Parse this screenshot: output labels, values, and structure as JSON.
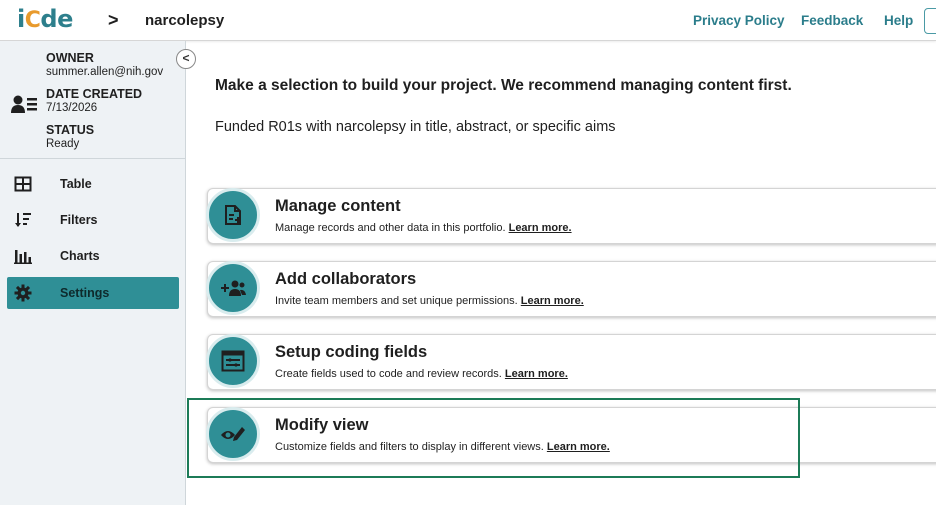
{
  "header": {
    "logo_prefix": "i",
    "logo_gear": "C",
    "logo_suffix": "de",
    "separator": ">",
    "project_name": "narcolepsy",
    "links": {
      "privacy": "Privacy Policy",
      "feedback": "Feedback",
      "help": "Help"
    }
  },
  "sidebar": {
    "collapse_glyph": "<",
    "meta": {
      "owner_label": "OWNER",
      "owner_value": "summer.allen@nih.gov",
      "created_label": "DATE CREATED",
      "created_value": "7/13/2026",
      "status_label": "STATUS",
      "status_value": "Ready"
    },
    "items": [
      {
        "label": "Table",
        "icon": "table-icon",
        "active": false
      },
      {
        "label": "Filters",
        "icon": "filter-sort-icon",
        "active": false
      },
      {
        "label": "Charts",
        "icon": "bar-chart-icon",
        "active": false
      },
      {
        "label": "Settings",
        "icon": "gear-icon",
        "active": true
      }
    ]
  },
  "main": {
    "headline": "Make a selection to build your project. We recommend managing content first.",
    "description": "Funded R01s with narcolepsy in title, abstract, or specific aims",
    "cards": [
      {
        "title": "Manage content",
        "desc": "Manage records and other data in this portfolio.",
        "link": "Learn more.",
        "icon": "document-add-icon"
      },
      {
        "title": "Add collaborators",
        "desc": "Invite team members and set unique permissions.",
        "link": "Learn more.",
        "icon": "group-add-icon"
      },
      {
        "title": "Setup coding fields",
        "desc": "Create fields used to code and review records.",
        "link": "Learn more.",
        "icon": "form-fields-icon"
      },
      {
        "title": "Modify view",
        "desc": "Customize fields and filters to display in different views.",
        "link": "Learn more.",
        "icon": "eye-edit-icon"
      }
    ]
  },
  "colors": {
    "accent": "#2f8f96",
    "link": "#2b7d8b",
    "logo_gear": "#e89a2c",
    "highlight": "#1c7b57"
  }
}
